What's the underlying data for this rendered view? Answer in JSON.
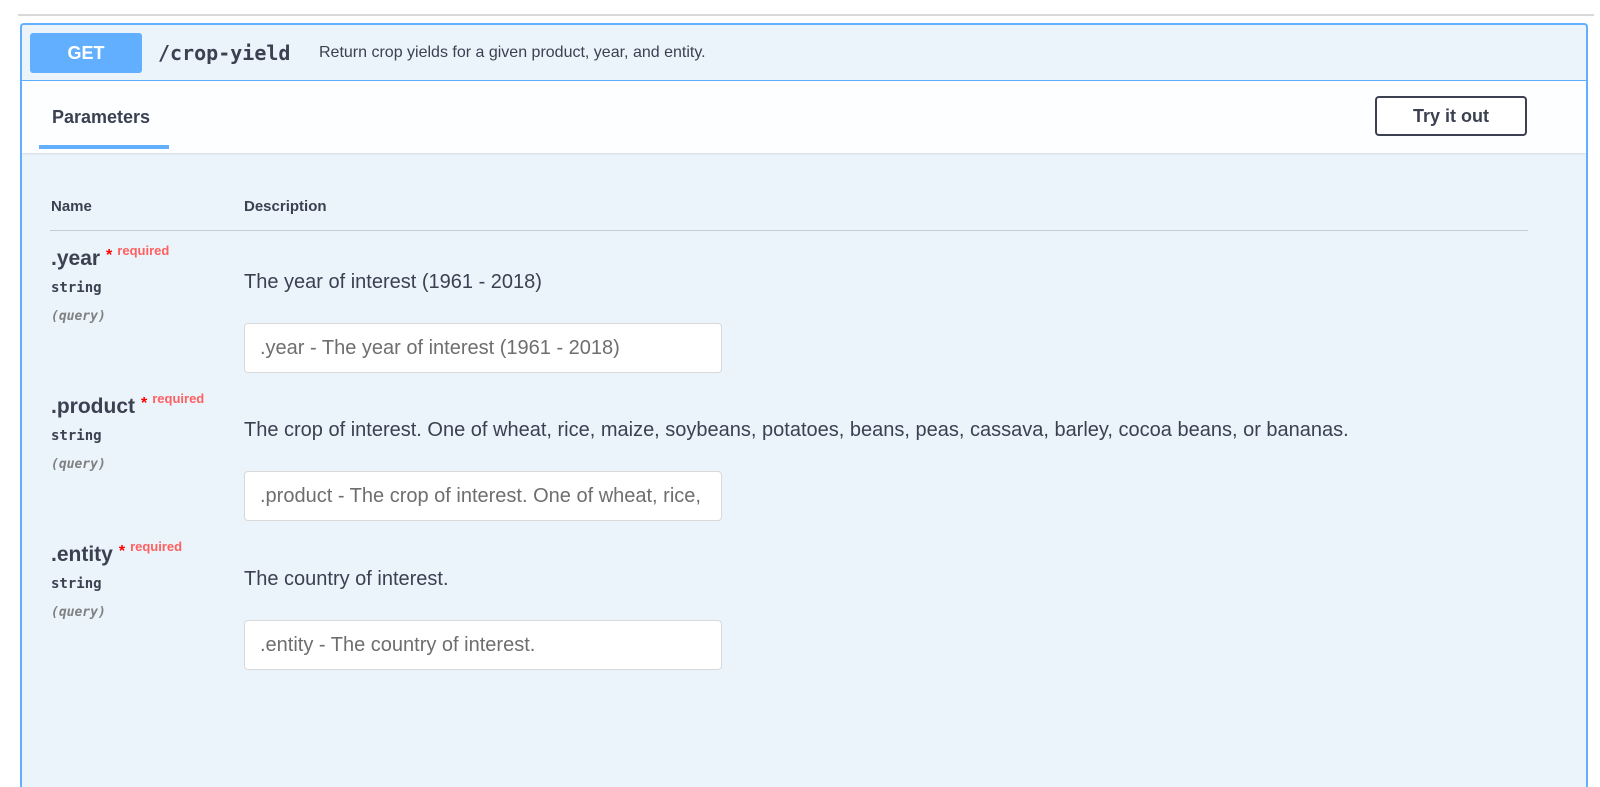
{
  "operation": {
    "method": "GET",
    "path": "/crop-yield",
    "summary": "Return crop yields for a given product, year, and entity."
  },
  "section": {
    "tab_label": "Parameters",
    "try_button_label": "Try it out"
  },
  "table": {
    "headers": {
      "name": "Name",
      "description": "Description"
    }
  },
  "parameters": [
    {
      "name": ".year",
      "star": "*",
      "required_label": "required",
      "type": "string",
      "location": "(query)",
      "description": "The year of interest (1961 - 2018)",
      "placeholder": ".year - The year of interest (1961 - 2018)"
    },
    {
      "name": ".product",
      "star": "*",
      "required_label": "required",
      "type": "string",
      "location": "(query)",
      "description": "The crop of interest. One of wheat, rice, maize, soybeans, potatoes, beans, peas, cassava, barley, cocoa beans, or bananas.",
      "placeholder": ".product - The crop of interest. One of wheat, rice, maize, soybeans, potatoes, beans, peas, cassava, barley, cocoa beans, or bananas."
    },
    {
      "name": ".entity",
      "star": "*",
      "required_label": "required",
      "type": "string",
      "location": "(query)",
      "description": "The country of interest.",
      "placeholder": ".entity - The country of interest."
    }
  ],
  "colors": {
    "accent": "#61affe",
    "background": "#ebf3fb",
    "text": "#3b4151",
    "required": "#ff6060"
  }
}
